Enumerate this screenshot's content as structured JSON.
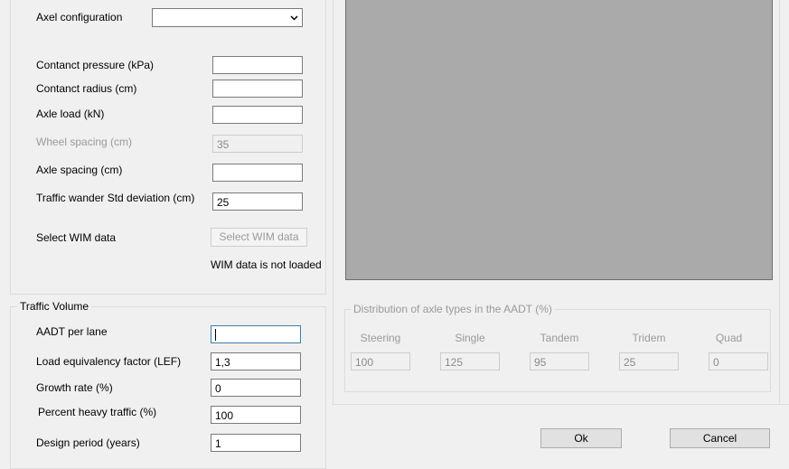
{
  "axle_section": {
    "axle_configuration_label": "Axel configuration",
    "axle_configuration_value": "",
    "contact_pressure_label": "Contanct pressure (kPa)",
    "contact_pressure_value": "",
    "contact_radius_label": "Contanct radius (cm)",
    "contact_radius_value": "",
    "axle_load_label": "Axle load (kN)",
    "axle_load_value": "",
    "wheel_spacing_label": "Wheel spacing (cm)",
    "wheel_spacing_value": "35",
    "axle_spacing_label": "Axle spacing (cm)",
    "axle_spacing_value": "",
    "traffic_wander_label": "Traffic wander Std deviation (cm)",
    "traffic_wander_value": "25",
    "select_wim_label": "Select WIM data",
    "select_wim_button": "Select WIM data",
    "wim_status": "WIM data is not loaded"
  },
  "traffic_volume": {
    "title": "Traffic Volume",
    "aadt_label": "AADT per lane",
    "aadt_value": "",
    "lef_label": "Load equivalency factor (LEF)",
    "lef_value": "1,3",
    "growth_label": "Growth rate (%)",
    "growth_value": "0",
    "heavy_label": "Percent heavy traffic (%)",
    "heavy_value": "100",
    "design_label": "Design period (years)",
    "design_value": "1"
  },
  "distribution": {
    "title": "Distribution of axle types in the AADT (%)",
    "columns": [
      {
        "label": "Steering",
        "value": "100"
      },
      {
        "label": "Single",
        "value": "125"
      },
      {
        "label": "Tandem",
        "value": "95"
      },
      {
        "label": "Tridem",
        "value": "25"
      },
      {
        "label": "Quad",
        "value": "0"
      }
    ]
  },
  "buttons": {
    "ok": "Ok",
    "cancel": "Cancel"
  },
  "colors": {
    "preview_bg": "#aaaaaa",
    "window_bg": "#f0f0f0"
  }
}
